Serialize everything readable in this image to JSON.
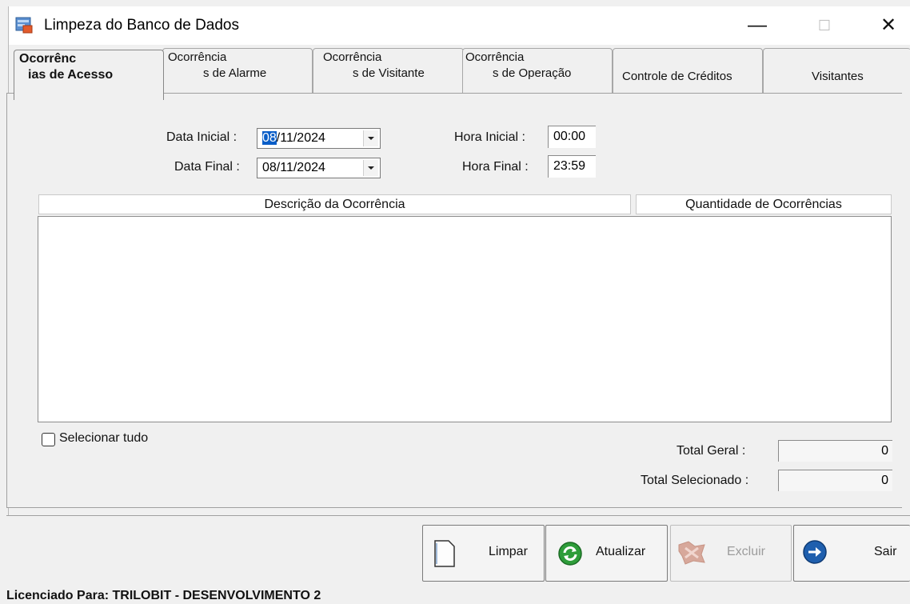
{
  "window": {
    "title": "Limpeza do Banco de Dados",
    "controls": {
      "minimize": "—",
      "maximize": "☐",
      "close": "✕"
    }
  },
  "tabs": [
    {
      "line1": "Ocorrênc",
      "line2": "ias de Acesso",
      "active": true
    },
    {
      "line1": "Ocorrência",
      "line2": "s de Alarme",
      "active": false
    },
    {
      "line1": "Ocorrência",
      "line2": "s de Visitante",
      "active": false
    },
    {
      "line1": "Ocorrência",
      "line2": "s de Operação",
      "active": false
    },
    {
      "line1": "Controle de Créditos",
      "active": false
    },
    {
      "line1": "Visitantes",
      "active": false
    }
  ],
  "filters": {
    "data_inicial_label": "Data Inicial :",
    "data_inicial_sel": "08",
    "data_inicial_rest": "/11/2024",
    "data_final_label": "Data Final :",
    "data_final_value": "08/11/2024",
    "hora_inicial_label": "Hora Inicial :",
    "hora_inicial_value": "00:00",
    "hora_final_label": "Hora Final :",
    "hora_final_value": "23:59"
  },
  "table": {
    "columns": [
      "Descrição da Ocorrência",
      "Quantidade de Ocorrências"
    ],
    "rows": []
  },
  "select_all_label": "Selecionar tudo",
  "totals": {
    "geral_label": "Total Geral :",
    "geral_value": "0",
    "selecionado_label": "Total Selecionado :",
    "selecionado_value": "0"
  },
  "buttons": {
    "limpar": "Limpar",
    "atualizar": "Atualizar",
    "excluir": "Excluir",
    "sair": "Sair"
  },
  "status": "Licenciado Para: TRILOBIT - DESENVOLVIMENTO 2",
  "icons": {
    "app": "database-cleanup-icon",
    "limpar": "blank-document-icon",
    "atualizar": "refresh-icon",
    "excluir": "delete-icon",
    "sair": "exit-arrow-icon"
  },
  "colors": {
    "selection": "#0a5ec8",
    "refresh_green": "#2e9d3a",
    "exit_blue": "#1f5fae"
  }
}
